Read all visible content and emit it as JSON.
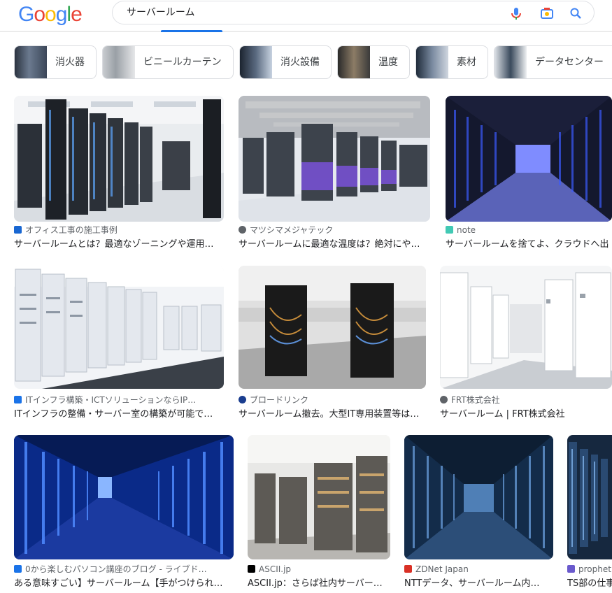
{
  "header": {
    "logo_letters": [
      "G",
      "o",
      "o",
      "g",
      "l",
      "e"
    ],
    "logo_colors": [
      "#4285f4",
      "#ea4335",
      "#fbbc05",
      "#4285f4",
      "#34a853",
      "#ea4335"
    ],
    "search_query": "サーバールーム"
  },
  "chips": [
    {
      "label": "消火器"
    },
    {
      "label": "ビニールカーテン"
    },
    {
      "label": "消火設備"
    },
    {
      "label": "温度"
    },
    {
      "label": "素材"
    },
    {
      "label": "データセンター"
    }
  ],
  "results": [
    {
      "source": "オフィス工事の施工事例",
      "title": "サーバールームとは？最適なゾーニングや運用…"
    },
    {
      "source": "マツシマメジャテック",
      "title": "サーバールームに最適な温度は？絶対にや…"
    },
    {
      "source": "note",
      "title": "サーバールームを捨てよ、クラウドへ出"
    },
    {
      "source": "ITインフラ構築・ICTソリューションならIP…",
      "title": "ITインフラの整備・サーバー室の構築が可能で…"
    },
    {
      "source": "ブロードリンク",
      "title": "サーバールーム撤去。大型IT専用装置等は…"
    },
    {
      "source": "FRT株式会社",
      "title": "サーバールーム | FRT株式会社"
    },
    {
      "source": "0から楽しむパソコン講座のブログ - ライブド…",
      "title": "ある意味すごい】サーバールーム【手がつけられ…"
    },
    {
      "source": "ASCII.jp",
      "title": "ASCII.jp：さらば社内サーバー…"
    },
    {
      "source": "ZDNet Japan",
      "title": "NTTデータ、サーバールーム内…"
    },
    {
      "source": "prophet",
      "title": "TS部の仕事"
    }
  ]
}
